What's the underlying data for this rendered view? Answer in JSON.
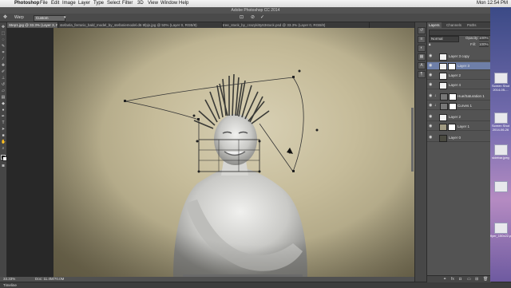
{
  "menubar": {
    "app": "Photoshop",
    "items": [
      "File",
      "Edit",
      "Image",
      "Layer",
      "Type",
      "Select",
      "Filter",
      "3D",
      "View",
      "Window",
      "Help"
    ],
    "clock": "Mon 12:54 PM"
  },
  "window": {
    "title": "Adobe Photoshop CC 2014"
  },
  "options": {
    "mode": "Warp",
    "preset": "Custom"
  },
  "tabs": [
    "Step1.jpg @ 33.3% (Layer 3, RGB/8#)",
    "stefanla_ferrario_bald_model_by_stefaniemodel.d6 9fpjs.jpg @ 50% (Layer 0, RGB/8)",
    "tree_stock_by_crazykitty63stock.psd @ 33.3% (Layer 0, RGB/8)"
  ],
  "status": {
    "zoom": "33.33%",
    "doc": "Doc: 11.4M/70.0M"
  },
  "timeline": "Timeline",
  "panels": {
    "tabs": [
      "Layers",
      "Channels",
      "Paths"
    ],
    "blend": "Normal",
    "opacity_label": "Opacity:",
    "opacity": "100%",
    "fill_label": "Fill:",
    "fill": "100%",
    "layers": [
      {
        "name": "Layer 3 copy",
        "thumb": "white",
        "selected": false
      },
      {
        "name": "Layer 3",
        "thumb": "white",
        "selected": true
      },
      {
        "name": "Layer 2",
        "thumb": "white",
        "selected": false
      },
      {
        "name": "Layer 4",
        "thumb": "white",
        "selected": false
      },
      {
        "name": "Hue/Saturation 1",
        "thumb": "adjust",
        "selected": false
      },
      {
        "name": "Curves 1",
        "thumb": "adjust",
        "selected": false
      },
      {
        "name": "Layer 2",
        "thumb": "white",
        "selected": false
      },
      {
        "name": "Layer 1",
        "thumb": "paper",
        "selected": false
      },
      {
        "name": "Layer 0",
        "thumb": "dark",
        "selected": false
      }
    ]
  },
  "desktop": {
    "labels": [
      "Screen Shot 2014-05-...",
      "Screen Shot 2014-06-26",
      "sidebar.jpeg",
      "",
      "flyer_150x22.psd"
    ]
  },
  "colors": {
    "selected_layer": "#6e7fa8",
    "canvas_paper": "#c6bc9a"
  }
}
